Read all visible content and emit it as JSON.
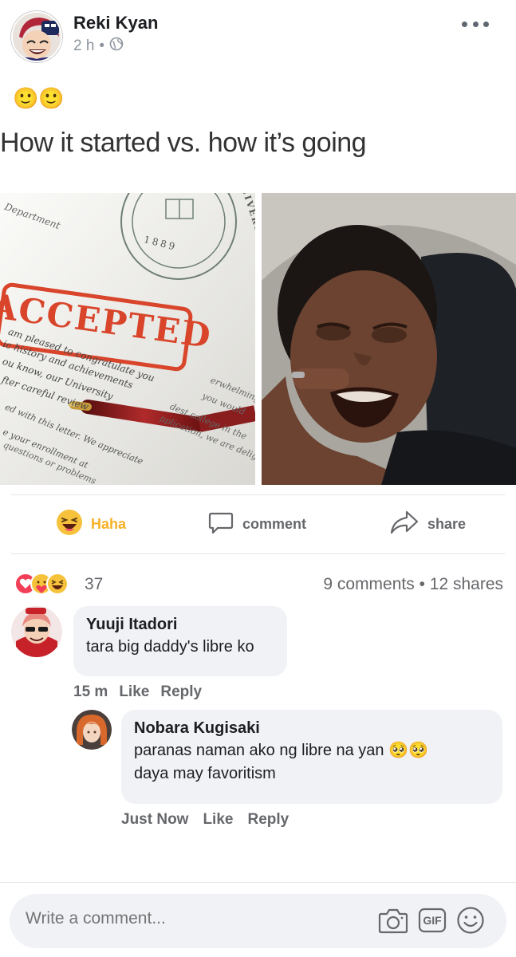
{
  "post": {
    "author": "Reki Kyan",
    "time": "2 h",
    "separator": "•",
    "privacy_icon": "globe-icon",
    "emoji": "🙂🙂",
    "caption": "How it started vs. how it’s going"
  },
  "meme": {
    "left_texts": [
      "Department",
      "1889",
      "ACCEPTED",
      "am pleased to congratulate you",
      "ic history and achievements",
      "ou know, our University",
      "fter careful review",
      "ed with this letter. We appreciate",
      "e your enrollment at",
      "questions or problems",
      "dest college in the",
      "pplication, we are delig",
      "you would",
      "erwhelming"
    ],
    "seal_text": "UNIVERSITY",
    "right_description": ""
  },
  "actions": {
    "haha_label": "Haha",
    "comment_label": "comment",
    "share_label": "share"
  },
  "stats": {
    "reactions_count": "37",
    "comments_shares": "9 comments • 12 shares"
  },
  "comments": [
    {
      "name": "Yuuji Itadori",
      "text": "tara big daddy's libre ko",
      "time": "15 m",
      "like": "Like",
      "reply": "Reply"
    },
    {
      "name": "Nobara Kugisaki",
      "text_line1": "paranas naman ako ng libre na yan 🥺🥺",
      "text_line2": "daya may favoritism",
      "time": "Just Now",
      "like": "Like",
      "reply": "Reply"
    }
  ],
  "composer": {
    "placeholder": "Write a comment...",
    "icons": [
      "camera-icon",
      "gif-icon",
      "smiley-icon"
    ],
    "gif_label": "GIF"
  },
  "colors": {
    "haha": "#f7b125",
    "love": "#f33e58",
    "muted": "#65676b",
    "bubble": "#f0f2f5"
  }
}
